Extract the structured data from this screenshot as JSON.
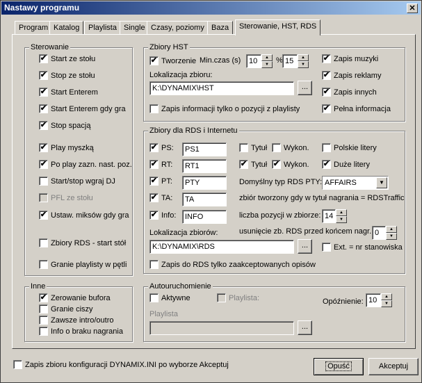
{
  "window": {
    "title": "Nastawy programu",
    "close_icon": "close-icon"
  },
  "tabs": [
    {
      "label": "Program"
    },
    {
      "label": "Katalog"
    },
    {
      "label": "Playlista"
    },
    {
      "label": "Single"
    },
    {
      "label": "Czasy, poziomy"
    },
    {
      "label": "Baza"
    },
    {
      "label": "Sterowanie, HST, RDS",
      "active": true
    }
  ],
  "sterowanie": {
    "title": "Sterowanie",
    "items": [
      {
        "label": "Start ze stołu",
        "checked": "✔"
      },
      {
        "label": "Stop ze stołu",
        "checked": "✔"
      },
      {
        "label": "Start Enterem",
        "checked": "✔"
      },
      {
        "label": "Start Enterem gdy gra",
        "checked": "✔"
      },
      {
        "label": "Stop spacją",
        "checked": "✔"
      },
      {
        "label": "Play myszką",
        "checked": "✔"
      },
      {
        "label": "Po play zazn. nast. poz.",
        "checked": "✔"
      },
      {
        "label": "Start/stop wgraj DJ",
        "checked": ""
      },
      {
        "label": "PFL ze stołu",
        "checked": ""
      },
      {
        "label": "Ustaw. miksów gdy gra",
        "checked": "✔"
      },
      {
        "label": "Zbiory RDS - start stół",
        "checked": ""
      },
      {
        "label": "Granie playlisty w pętli",
        "checked": ""
      }
    ]
  },
  "inne": {
    "title": "Inne",
    "items": [
      {
        "label": "Zerowanie bufora",
        "checked": "✔"
      },
      {
        "label": "Granie ciszy",
        "checked": ""
      },
      {
        "label": "Zawsze intro/outro",
        "checked": ""
      },
      {
        "label": "Info o braku nagrania",
        "checked": ""
      }
    ]
  },
  "hst": {
    "title": "Zbiory HST",
    "tworzenie_label": "Tworzenie",
    "tworzenie_checked": "✔",
    "min_czas_label": "Min.czas (s)",
    "min_czas_value": "10",
    "percent_label": "%",
    "percent_value": "15",
    "lokalizacja_label": "Lokalizacja zbioru:",
    "path": "K:\\DYNAMIX\\HST",
    "browse": "...",
    "zapis_info_label": "Zapis informacji tylko o pozycji z playlisty",
    "zapis_info_checked": "",
    "right": [
      {
        "label": "Zapis muzyki",
        "checked": "✔"
      },
      {
        "label": "Zapis reklamy",
        "checked": "✔"
      },
      {
        "label": "Zapis innych",
        "checked": "✔"
      },
      {
        "label": "Pełna informacja",
        "checked": "✔"
      }
    ]
  },
  "rds": {
    "title": "Zbiory dla RDS i Internetu",
    "fields": [
      {
        "label": "PS:",
        "checked": "✔",
        "value": "PS1"
      },
      {
        "label": "RT:",
        "checked": "✔",
        "value": "RT1"
      },
      {
        "label": "PT:",
        "checked": "✔",
        "value": "PTY"
      },
      {
        "label": "TA:",
        "checked": "✔",
        "value": "TA"
      },
      {
        "label": "Info:",
        "checked": "✔",
        "value": "INFO"
      }
    ],
    "row1": {
      "tytul": "Tytuł",
      "tytul_checked": "",
      "wykon": "Wykon.",
      "wykon_checked": "",
      "polskie": "Polskie litery",
      "polskie_checked": ""
    },
    "row2": {
      "tytul": "Tytuł",
      "tytul_checked": "✔",
      "wykon": "Wykon.",
      "wykon_checked": "✔",
      "duze": "Duże litery",
      "duze_checked": "✔"
    },
    "pty_label": "Domyślny typ RDS PTY:",
    "pty_value": "AFFAIRS",
    "traffic_label": "zbiór tworzony gdy w tytuł nagrania = RDSTraffic",
    "liczba_label": "liczba pozycji w zbiorze:",
    "liczba_value": "14",
    "usuniecie_label": "usunięcie zb. RDS przed końcem nagr.",
    "usuniecie_value": "0",
    "lokalizacja_label": "Lokalizacja zbiorów:",
    "path": "K:\\DYNAMIX\\RDS",
    "browse": "...",
    "ext_label": "Ext. = nr stanowiska",
    "ext_checked": "",
    "zapis_label": "Zapis do RDS tylko zaakceptowanych opisów",
    "zapis_checked": ""
  },
  "auto": {
    "title": "Autouruchomienie",
    "aktywne_label": "Aktywne",
    "aktywne_checked": "",
    "playlista_cb_label": "Playlista:",
    "playlista_cb_checked": "",
    "opoznienie_label": "Opóźnienie:",
    "opoznienie_value": "10",
    "playlista_label": "Playlista",
    "playlista_value": "",
    "browse": "..."
  },
  "footer": {
    "zapis_label": "Zapis zbioru konfiguracji DYNAMIX.INI po wyborze Akceptuj",
    "zapis_checked": "",
    "cancel": "Opuść",
    "accept": "Akceptuj"
  }
}
